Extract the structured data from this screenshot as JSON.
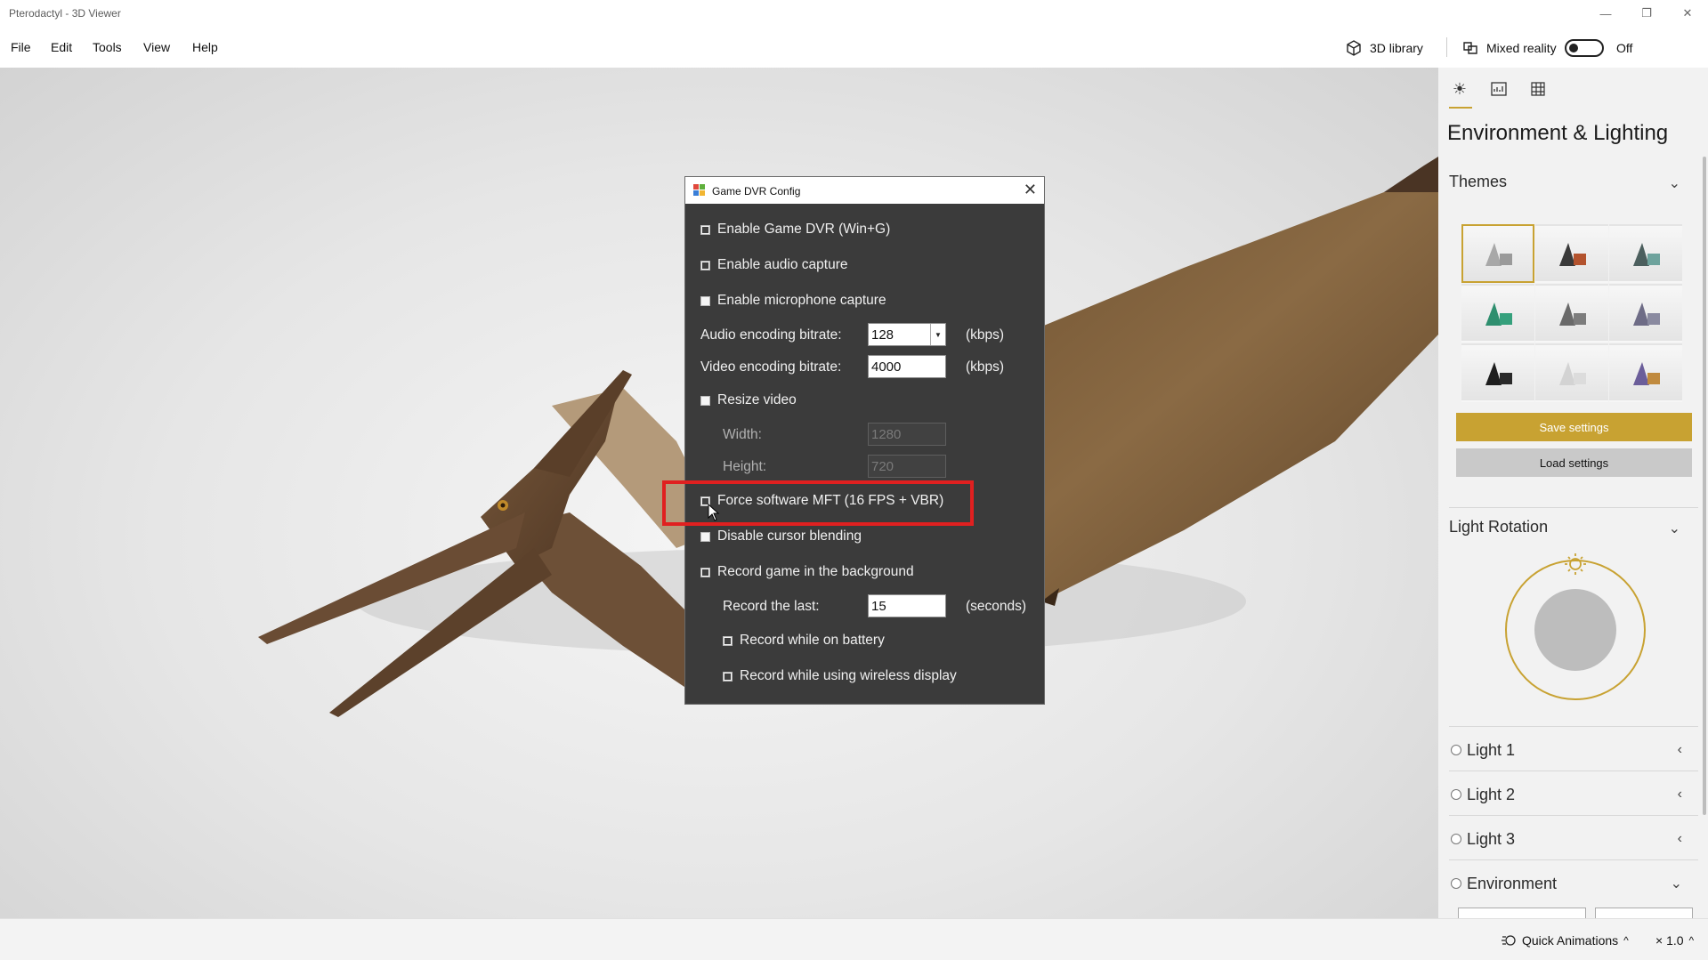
{
  "window": {
    "title": "Pterodactyl - 3D Viewer",
    "controls": {
      "minimize": "—",
      "restore": "❐",
      "close": "✕"
    }
  },
  "menu": {
    "items": [
      "File",
      "Edit",
      "Tools",
      "View",
      "Help"
    ],
    "library_label": "3D library",
    "mixed_reality_label": "Mixed reality",
    "mixed_reality_state": "Off"
  },
  "dialog": {
    "title": "Game DVR Config",
    "close": "✕",
    "options": {
      "enable_dvr": {
        "label": "Enable Game DVR (Win+G)",
        "checked": true
      },
      "enable_audio": {
        "label": "Enable audio capture",
        "checked": true
      },
      "enable_mic": {
        "label": "Enable microphone capture",
        "checked": false
      },
      "resize_video": {
        "label": "Resize video",
        "checked": false
      },
      "force_mft": {
        "label": "Force software MFT (16 FPS + VBR)",
        "checked": true
      },
      "disable_cursor": {
        "label": "Disable cursor blending",
        "checked": false
      },
      "record_bg": {
        "label": "Record game in the background",
        "checked": true
      },
      "record_battery": {
        "label": "Record while on battery",
        "checked": true
      },
      "record_wireless": {
        "label": "Record while using wireless display",
        "checked": true
      }
    },
    "audio_bitrate": {
      "label": "Audio encoding bitrate:",
      "value": "128",
      "unit": "(kbps)"
    },
    "video_bitrate": {
      "label": "Video encoding bitrate:",
      "value": "4000",
      "unit": "(kbps)"
    },
    "width": {
      "label": "Width:",
      "value": "1280"
    },
    "height": {
      "label": "Height:",
      "value": "720"
    },
    "record_last": {
      "label": "Record the last:",
      "value": "15",
      "unit": "(seconds)"
    }
  },
  "panel": {
    "title": "Environment & Lighting",
    "themes_label": "Themes",
    "save_label": "Save settings",
    "load_label": "Load settings",
    "light_rotation_label": "Light Rotation",
    "lights": [
      "Light 1",
      "Light 2",
      "Light 3"
    ],
    "environment_label": "Environment",
    "accent_color": "#c8a232"
  },
  "status": {
    "quick_animations": "Quick Animations",
    "speed": "× 1.0"
  }
}
